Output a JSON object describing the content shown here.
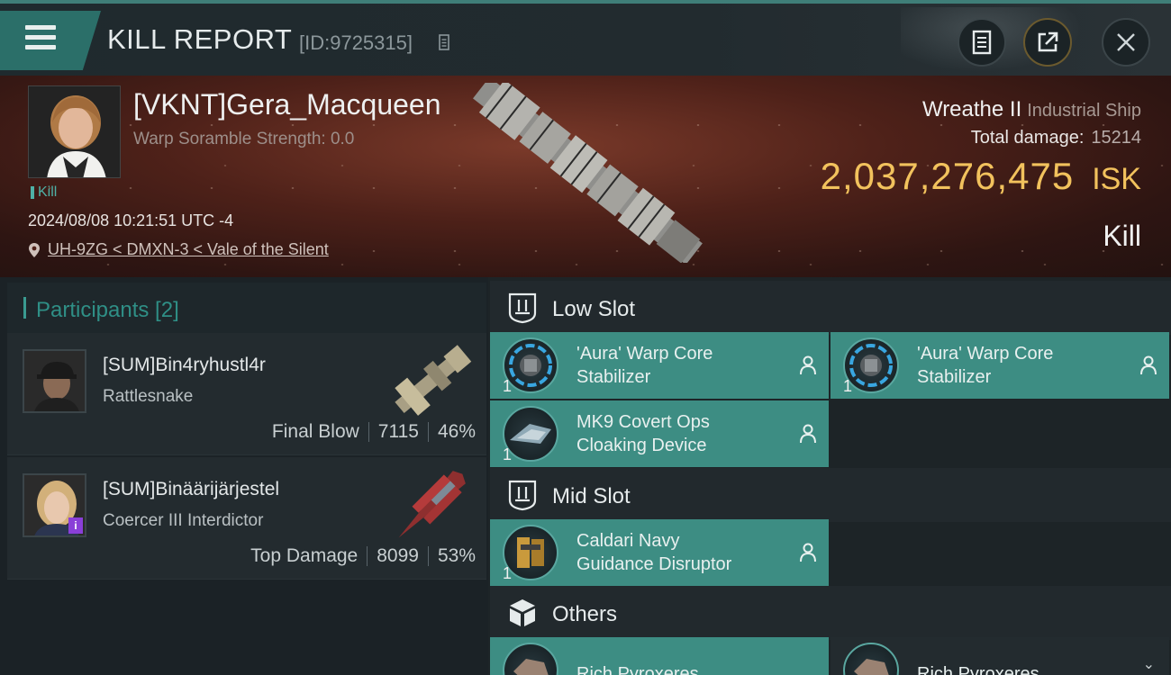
{
  "header": {
    "title": "KILL REPORT",
    "report_id": "[ID:9725315]",
    "accent_color": "#2b6f69"
  },
  "victim": {
    "name": "[VKNT]Gera_Macqueen",
    "warp_scramble": "Warp Soramble Strength: 0.0",
    "kill_tag": "Kill",
    "date": "2024/08/08 10:21:51 UTC -4",
    "location": "UH-9ZG < DMXN-3 < Vale of the Silent",
    "ship_name": "Wreathe II",
    "ship_class": "Industrial Ship",
    "total_damage_label": "Total damage:",
    "total_damage": "15214",
    "isk_value": "2,037,276,475",
    "isk_unit": "ISK",
    "result": "Kill"
  },
  "participants": {
    "title": "Participants [2]",
    "rows": [
      {
        "name": "[SUM]Bin4ryhustl4r",
        "ship": "Rattlesnake",
        "role": "Final Blow",
        "damage": "7115",
        "percent": "46%"
      },
      {
        "name": "[SUM]Binäärijärjestel",
        "ship": "Coercer III Interdictor",
        "role": "Top Damage",
        "damage": "8099",
        "percent": "53%"
      }
    ]
  },
  "slots": {
    "low_label": "Low Slot",
    "mid_label": "Mid Slot",
    "others_label": "Others",
    "modules": [
      {
        "line1": "'Aura' Warp Core",
        "line2": "Stabilizer",
        "qty": "1"
      },
      {
        "line1": "'Aura' Warp Core",
        "line2": "Stabilizer",
        "qty": "1"
      },
      {
        "line1": "MK9 Covert Ops",
        "line2": "Cloaking Device",
        "qty": "1"
      },
      {
        "line1": "Caldari Navy",
        "line2": "Guidance Disruptor",
        "qty": "1"
      },
      {
        "line1": "Rich Pyroxeres",
        "line2": "",
        "qty": ""
      },
      {
        "line1": "Rich Pyroxeres",
        "line2": "",
        "qty": ""
      }
    ]
  },
  "icons": [
    "menu-icon",
    "notes-icon",
    "share-icon",
    "close-icon",
    "location-pin-icon",
    "slot-icon",
    "cargo-box-icon",
    "person-icon",
    "copy-icon"
  ]
}
